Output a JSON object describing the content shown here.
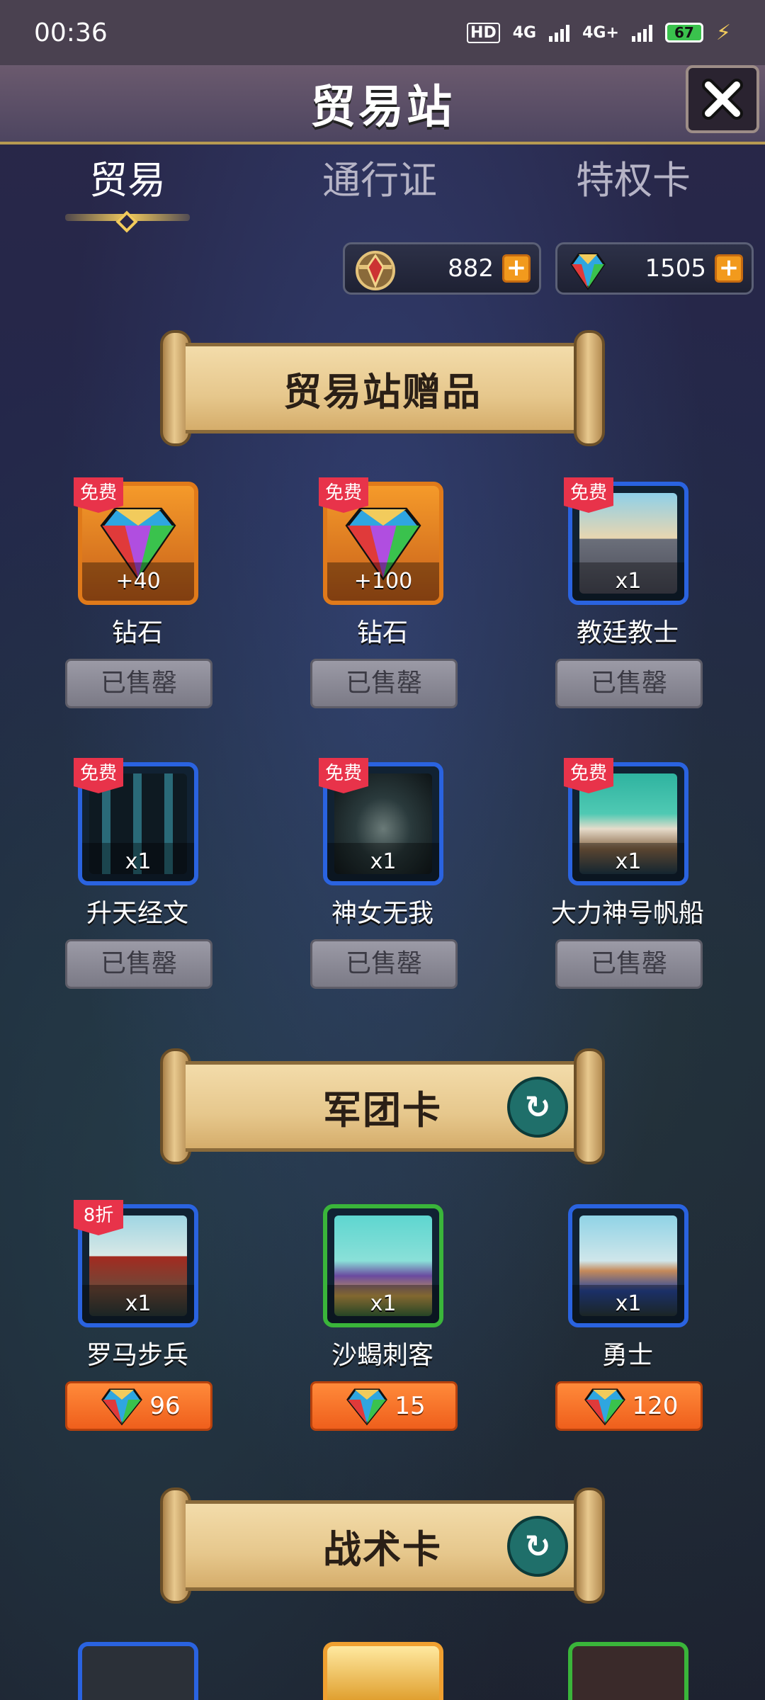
{
  "status_bar": {
    "time": "00:36",
    "network_a": "4G",
    "network_b": "4G+",
    "hd": "HD",
    "battery": "67"
  },
  "header": {
    "title": "贸易站"
  },
  "tabs": [
    {
      "label": "贸易",
      "active": true
    },
    {
      "label": "通行证",
      "active": false
    },
    {
      "label": "特权卡",
      "active": false
    }
  ],
  "currencies": [
    {
      "icon": "crest-icon",
      "value": "882"
    },
    {
      "icon": "diamond-icon",
      "value": "1505"
    }
  ],
  "sections": {
    "gifts": {
      "title": "贸易站赠品",
      "items": [
        {
          "tag": "免费",
          "count": "+40",
          "name": "钻石",
          "button": "已售罄",
          "frame": "orange",
          "art": "diamond"
        },
        {
          "tag": "免费",
          "count": "+100",
          "name": "钻石",
          "button": "已售罄",
          "frame": "orange",
          "art": "diamond"
        },
        {
          "tag": "免费",
          "count": "x1",
          "name": "教廷教士",
          "button": "已售罄",
          "frame": "blue",
          "art": "priest"
        },
        {
          "tag": "免费",
          "count": "x1",
          "name": "升天经文",
          "button": "已售罄",
          "frame": "blue",
          "art": "scripture"
        },
        {
          "tag": "免费",
          "count": "x1",
          "name": "神女无我",
          "button": "已售罄",
          "frame": "blue",
          "art": "goddess"
        },
        {
          "tag": "免费",
          "count": "x1",
          "name": "大力神号帆船",
          "button": "已售罄",
          "frame": "blue",
          "art": "ship"
        }
      ]
    },
    "legion": {
      "title": "军团卡",
      "items": [
        {
          "tag": "8折",
          "count": "x1",
          "name": "罗马步兵",
          "price": "96",
          "frame": "blue"
        },
        {
          "tag": "",
          "count": "x1",
          "name": "沙蝎刺客",
          "price": "15",
          "frame": "green"
        },
        {
          "tag": "",
          "count": "x1",
          "name": "勇士",
          "price": "120",
          "frame": "blue"
        }
      ]
    },
    "tactics": {
      "title": "战术卡"
    }
  }
}
